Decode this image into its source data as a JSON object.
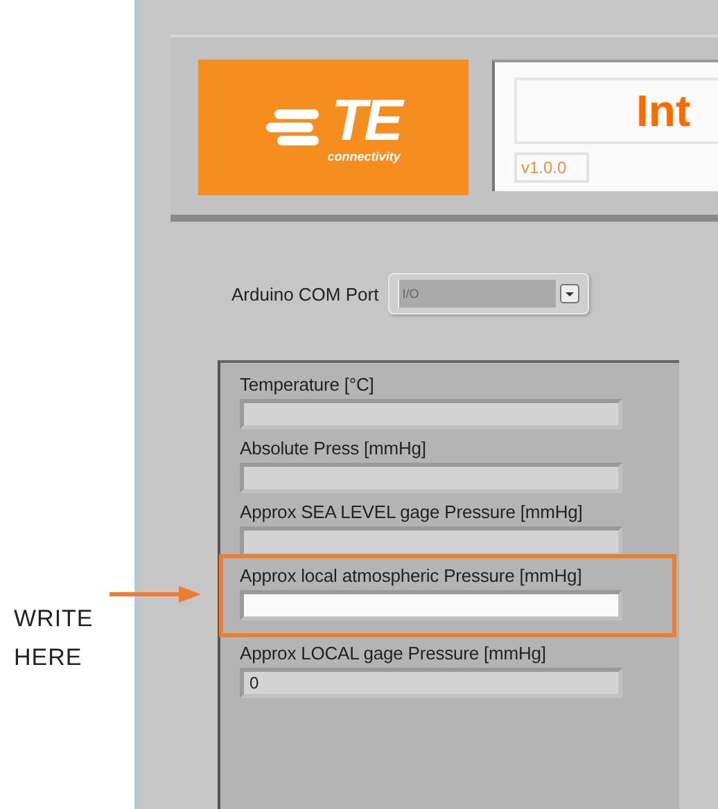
{
  "annotation": {
    "lines": [
      "WRITE",
      "HERE"
    ]
  },
  "header": {
    "logo": {
      "mark": "TE",
      "tagline": "connectivity"
    },
    "title": "Int",
    "version": "v1.0.0"
  },
  "com_port": {
    "label": "Arduino COM Port",
    "placeholder": "I/O"
  },
  "fields": [
    {
      "label": "Temperature [°C]",
      "kind": "indicator",
      "highlighted": false
    },
    {
      "label": "Absolute Press [mmHg]",
      "kind": "indicator",
      "highlighted": false
    },
    {
      "label": "Approx SEA LEVEL gage Pressure [mmHg]",
      "kind": "indicator",
      "highlighted": false
    },
    {
      "label": "Approx local atmospheric Pressure [mmHg]",
      "kind": "control",
      "highlighted": true
    },
    {
      "label": "Approx LOCAL gage Pressure [mmHg]",
      "kind": "indicator",
      "highlighted": false,
      "value": "0"
    }
  ]
}
